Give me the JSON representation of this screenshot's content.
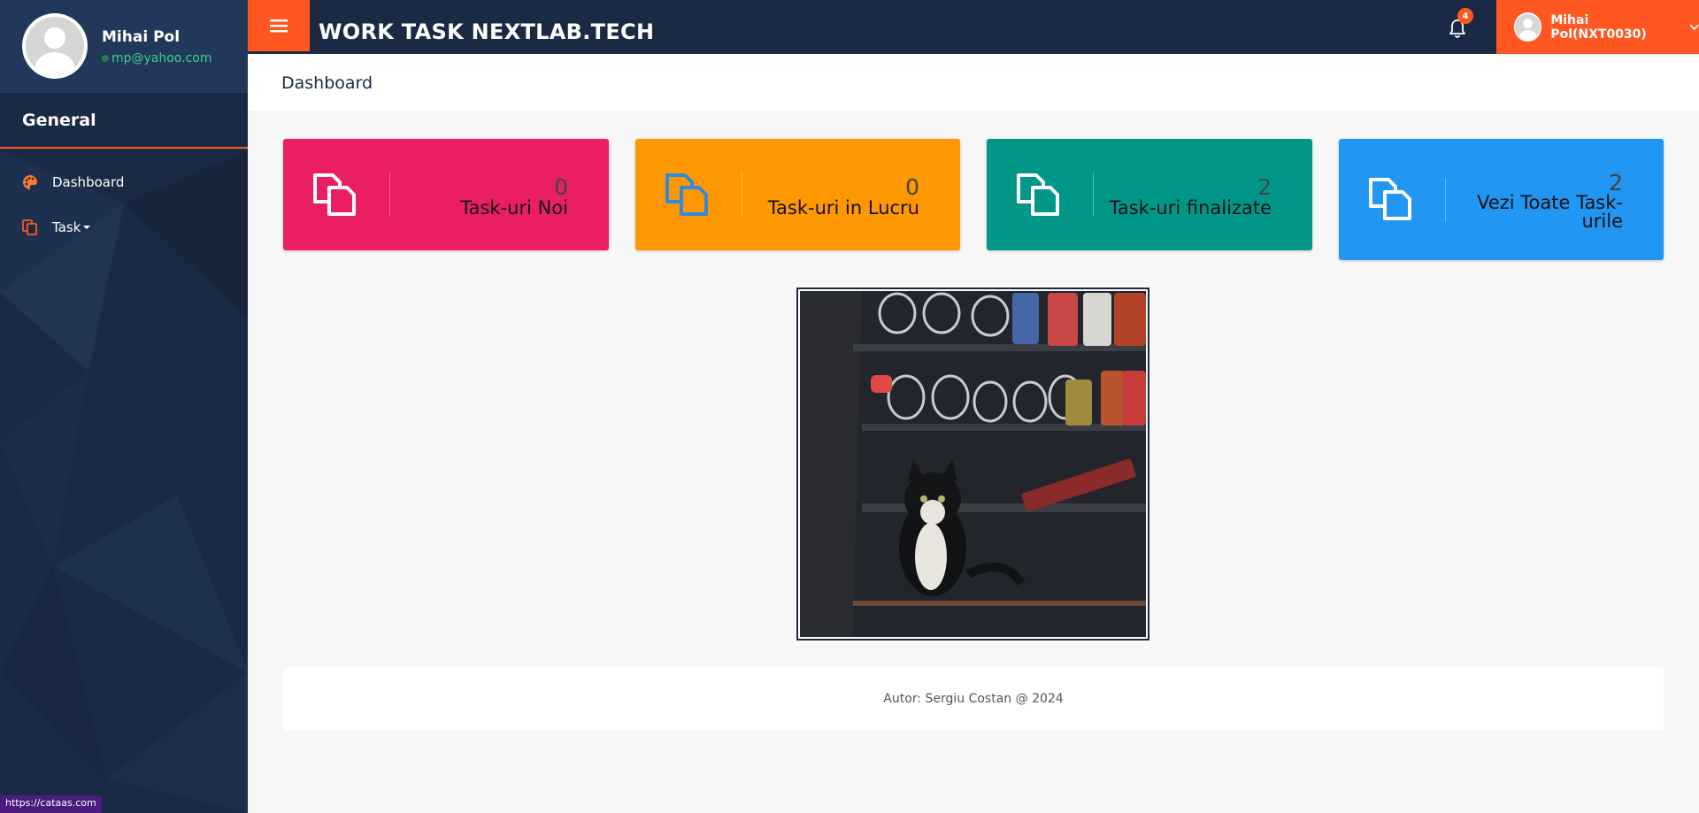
{
  "profile": {
    "name": "Mihai Pol",
    "email": "mp@yahoo.com"
  },
  "sidebar": {
    "section": "General",
    "items": [
      {
        "label": "Dashboard",
        "icon": "palette-icon"
      },
      {
        "label": "Task",
        "icon": "copy-icon",
        "has_dropdown": true
      }
    ]
  },
  "topbar": {
    "title": "WORK TASK NEXTLAB.TECH",
    "notifications_count": "4",
    "user_label": "Mihai Pol(NXT0030)"
  },
  "page": {
    "title": "Dashboard"
  },
  "cards": [
    {
      "value": "0",
      "label": "Task-uri Noi",
      "color": "#e91e63"
    },
    {
      "value": "0",
      "label": "Task-uri in Lucru",
      "color": "#ff9800"
    },
    {
      "value": "2",
      "label": "Task-uri finalizate",
      "color": "#009688"
    },
    {
      "value": "2",
      "label": "Vezi Toate Task-urile",
      "color": "#2196f3"
    }
  ],
  "footer": {
    "text": "Autor: Sergiu Costan @ 2024"
  },
  "status_bar": {
    "url": "https://cataas.com"
  },
  "colors": {
    "accent": "#ff5722",
    "navy": "#1b2a44",
    "email_green": "#3bcf88"
  }
}
